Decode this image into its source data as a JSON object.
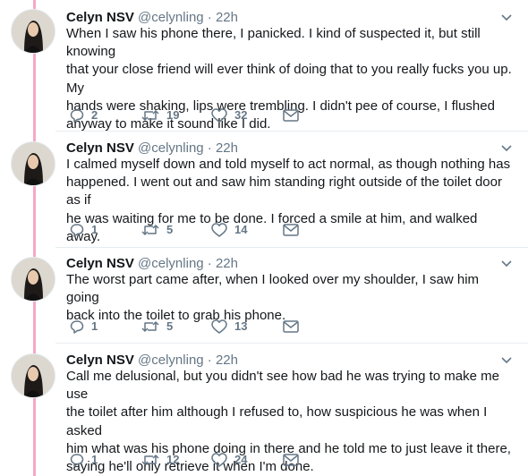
{
  "tweets": [
    {
      "name": "Celyn NSV",
      "handle": "@celynling",
      "time": "22h",
      "text": "When I saw his phone there, I panicked. I kind of suspected it, but still knowing\nthat your close friend will ever think of doing that to you really fucks you up. My\nhands were shaking, lips were trembling. I didn't pee of course, I flushed\nanyway to make it sound like I did.",
      "replies": "2",
      "retweets": "19",
      "likes": "32"
    },
    {
      "name": "Celyn NSV",
      "handle": "@celynling",
      "time": "22h",
      "text": "I calmed myself down and told myself to act normal, as though nothing has\nhappened. I went out and saw him standing right outside of the toilet door as if\nhe was waiting for me to be done. I forced a smile at him, and walked away.",
      "replies": "1",
      "retweets": "5",
      "likes": "14"
    },
    {
      "name": "Celyn NSV",
      "handle": "@celynling",
      "time": "22h",
      "text": "The worst part came after, when I looked over my shoulder, I saw him going\nback into the toilet to grab his phone.",
      "replies": "1",
      "retweets": "5",
      "likes": "13"
    },
    {
      "name": "Celyn NSV",
      "handle": "@celynling",
      "time": "22h",
      "text": "Call me delusional, but you didn't see how bad he was trying to make me use\nthe toilet after him although I refused to, how suspicious he was when I asked\nhim what was his phone doing in there and he told me to just leave it there,\nsaying he'll only retrieve it when I'm done.",
      "replies": "1",
      "retweets": "12",
      "likes": "24"
    }
  ],
  "separator": "·",
  "colors": {
    "thread_line": "#f5a9c8",
    "muted": "#657786",
    "text": "#14171a"
  },
  "icons": {
    "reply": "reply-icon",
    "retweet": "retweet-icon",
    "like": "heart-icon",
    "message": "envelope-icon",
    "caret": "chevron-down-icon"
  }
}
